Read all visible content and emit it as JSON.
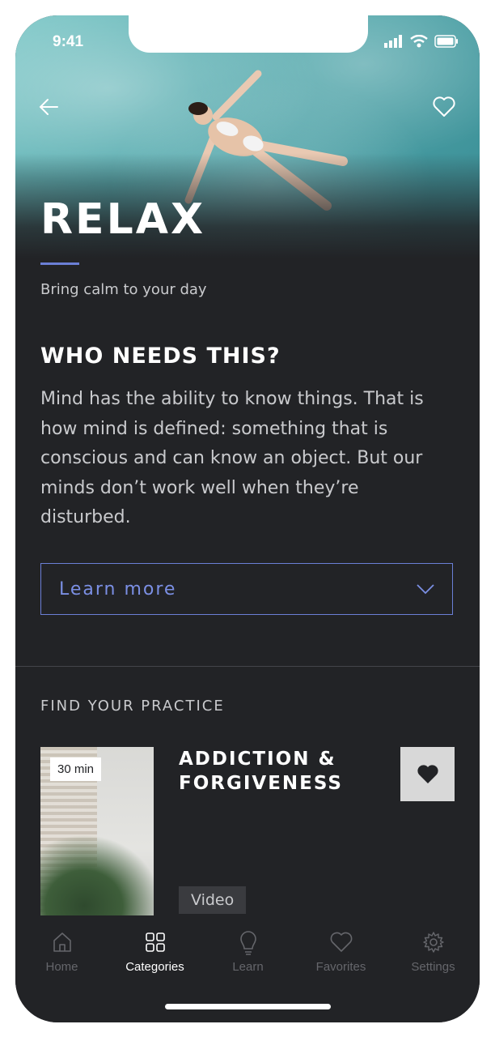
{
  "status": {
    "time": "9:41"
  },
  "hero": {
    "title": "RELAX",
    "subtitle": "Bring calm to your day"
  },
  "who": {
    "heading": "WHO NEEDS THIS?",
    "body": "Mind has the ability to know things. That is how mind is defined: something that is conscious and can know an object. But our minds don’t work well when they’re disturbed."
  },
  "learn_more": {
    "label": "Learn more"
  },
  "practice": {
    "heading": "FIND YOUR PRACTICE",
    "card": {
      "duration": "30 min",
      "title": "ADDICTION & FORGIVENESS",
      "type": "Video"
    }
  },
  "tabs": [
    {
      "label": "Home",
      "icon": "home-icon",
      "active": false
    },
    {
      "label": "Categories",
      "icon": "grid-icon",
      "active": true
    },
    {
      "label": "Learn",
      "icon": "lightbulb-icon",
      "active": false
    },
    {
      "label": "Favorites",
      "icon": "heart-icon",
      "active": false
    },
    {
      "label": "Settings",
      "icon": "gear-icon",
      "active": false
    }
  ],
  "colors": {
    "background": "#222326",
    "accent": "#6b7fd6",
    "text": "#c9cacd"
  }
}
